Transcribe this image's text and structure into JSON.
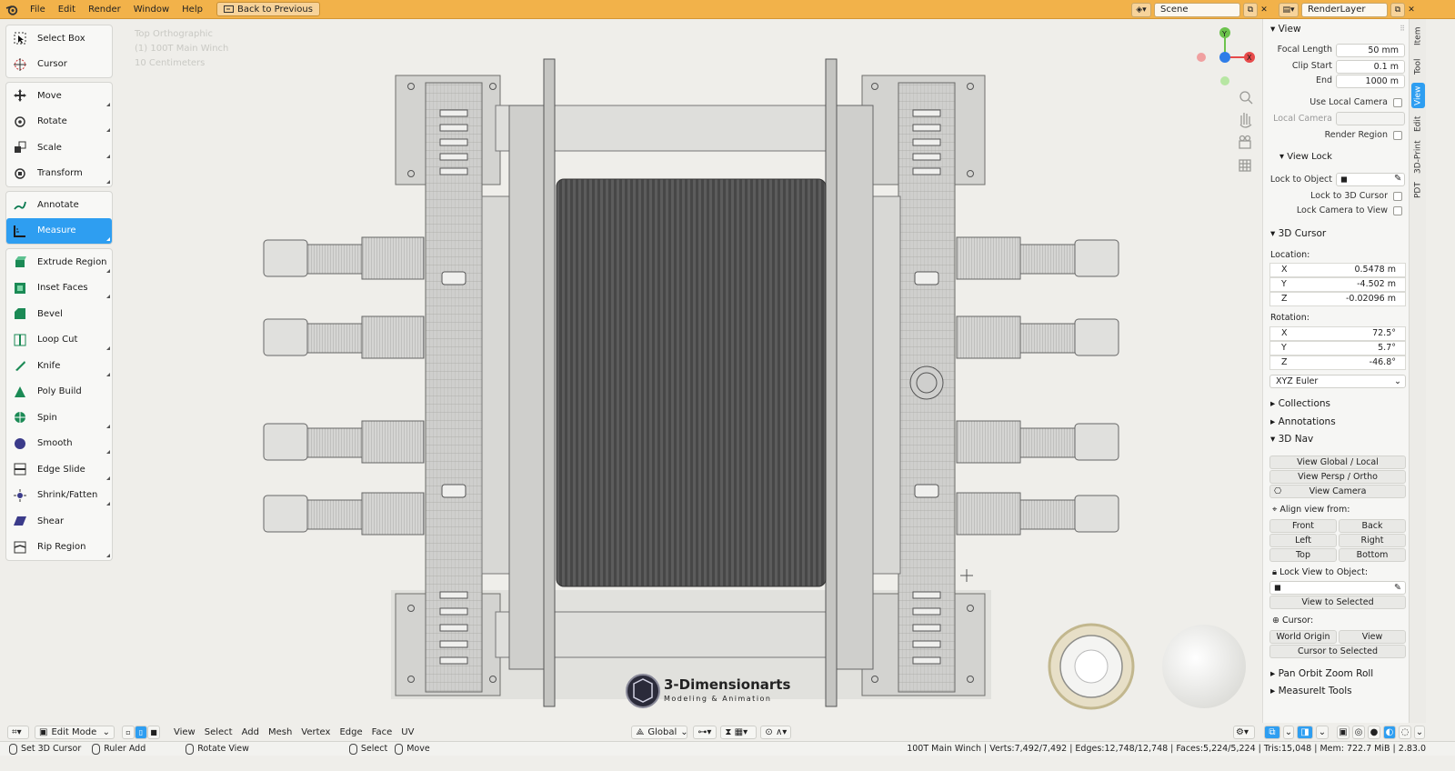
{
  "topbar": {
    "menus": [
      "File",
      "Edit",
      "Render",
      "Window",
      "Help"
    ],
    "back_label": "Back to Previous",
    "scene": "Scene",
    "render_layer": "RenderLayer"
  },
  "toolbar": {
    "tools": [
      {
        "label": "Select Box",
        "icon": "select-box-icon",
        "group": 1
      },
      {
        "label": "Cursor",
        "icon": "cursor-icon",
        "group": 1
      },
      {
        "label": "Move",
        "icon": "move-icon",
        "group": 2
      },
      {
        "label": "Rotate",
        "icon": "rotate-icon",
        "group": 2
      },
      {
        "label": "Scale",
        "icon": "scale-icon",
        "group": 2
      },
      {
        "label": "Transform",
        "icon": "transform-icon",
        "group": 2
      },
      {
        "label": "Annotate",
        "icon": "annotate-icon",
        "group": 3
      },
      {
        "label": "Measure",
        "icon": "measure-icon",
        "group": 3,
        "active": true
      },
      {
        "label": "Extrude Region",
        "icon": "extrude-icon",
        "group": 4
      },
      {
        "label": "Inset Faces",
        "icon": "inset-icon",
        "group": 4
      },
      {
        "label": "Bevel",
        "icon": "bevel-icon",
        "group": 4
      },
      {
        "label": "Loop Cut",
        "icon": "loop-cut-icon",
        "group": 4
      },
      {
        "label": "Knife",
        "icon": "knife-icon",
        "group": 4
      },
      {
        "label": "Poly Build",
        "icon": "poly-build-icon",
        "group": 4
      },
      {
        "label": "Spin",
        "icon": "spin-icon",
        "group": 4
      },
      {
        "label": "Smooth",
        "icon": "smooth-icon",
        "group": 4
      },
      {
        "label": "Edge Slide",
        "icon": "edge-slide-icon",
        "group": 4
      },
      {
        "label": "Shrink/Fatten",
        "icon": "shrink-icon",
        "group": 4
      },
      {
        "label": "Shear",
        "icon": "shear-icon",
        "group": 4
      },
      {
        "label": "Rip Region",
        "icon": "rip-icon",
        "group": 4
      }
    ]
  },
  "viewport": {
    "view_name": "Top Orthographic",
    "object_name": "(1) 100T Main Winch",
    "scale": "10 Centimeters",
    "watermark_title": "3-Dimensionarts",
    "watermark_sub": "Modeling & Animation"
  },
  "sidebar": {
    "tabs": [
      "Item",
      "Tool",
      "View",
      "Edit",
      "3D-Print",
      "PDT"
    ],
    "active_tab": "View",
    "view": {
      "header": "View",
      "focal_length_label": "Focal Length",
      "focal_length": "50 mm",
      "clip_start_label": "Clip Start",
      "clip_start": "0.1 m",
      "end_label": "End",
      "end": "1000 m",
      "use_local_camera": "Use Local Camera",
      "local_camera": "Local Camera",
      "render_region": "Render Region"
    },
    "view_lock": {
      "header": "View Lock",
      "lock_to_object": "Lock to Object",
      "lock_3d_cursor": "Lock to 3D Cursor",
      "lock_camera": "Lock Camera to View"
    },
    "cursor": {
      "header": "3D Cursor",
      "location_label": "Location:",
      "loc": [
        {
          "axis": "X",
          "value": "0.5478 m"
        },
        {
          "axis": "Y",
          "value": "-4.502 m"
        },
        {
          "axis": "Z",
          "value": "-0.02096 m"
        }
      ],
      "rotation_label": "Rotation:",
      "rot": [
        {
          "axis": "X",
          "value": "72.5°"
        },
        {
          "axis": "Y",
          "value": "5.7°"
        },
        {
          "axis": "Z",
          "value": "-46.8°"
        }
      ],
      "mode": "XYZ Euler"
    },
    "collections": "Collections",
    "annotations": "Annotations",
    "nav": {
      "header": "3D Nav",
      "view_global_local": "View Global / Local",
      "view_persp_ortho": "View Persp / Ortho",
      "view_camera": "View Camera",
      "align_label": "Align view from:",
      "front": "Front",
      "back": "Back",
      "left": "Left",
      "right": "Right",
      "top": "Top",
      "bottom": "Bottom",
      "lock_view_label": "Lock View to Object:",
      "view_selected": "View to Selected",
      "cursor_label": "Cursor:",
      "world_origin": "World Origin",
      "view": "View",
      "cursor_selected": "Cursor to Selected"
    },
    "pan_orbit": "Pan Orbit Zoom Roll",
    "measureit": "MeasureIt Tools"
  },
  "header": {
    "mode": "Edit Mode",
    "menus": [
      "View",
      "Select",
      "Add",
      "Mesh",
      "Vertex",
      "Edge",
      "Face",
      "UV"
    ],
    "orientation": "Global"
  },
  "status": {
    "set_cursor": "Set 3D Cursor",
    "ruler_add": "Ruler Add",
    "rotate_view": "Rotate View",
    "select": "Select",
    "move": "Move",
    "stats": "100T Main Winch | Verts:7,492/7,492 | Edges:12,748/12,748 | Faces:5,224/5,224 | Tris:15,048 | Mem: 722.7 MiB | 2.83.0"
  },
  "colors": {
    "accent": "#2e9ef1",
    "topbar": "#f2b24a",
    "viewport_bg": "#efeeea",
    "gizmo_x": "#e74a4a",
    "gizmo_y": "#6cc34c",
    "gizmo_z": "#2f7de8"
  }
}
